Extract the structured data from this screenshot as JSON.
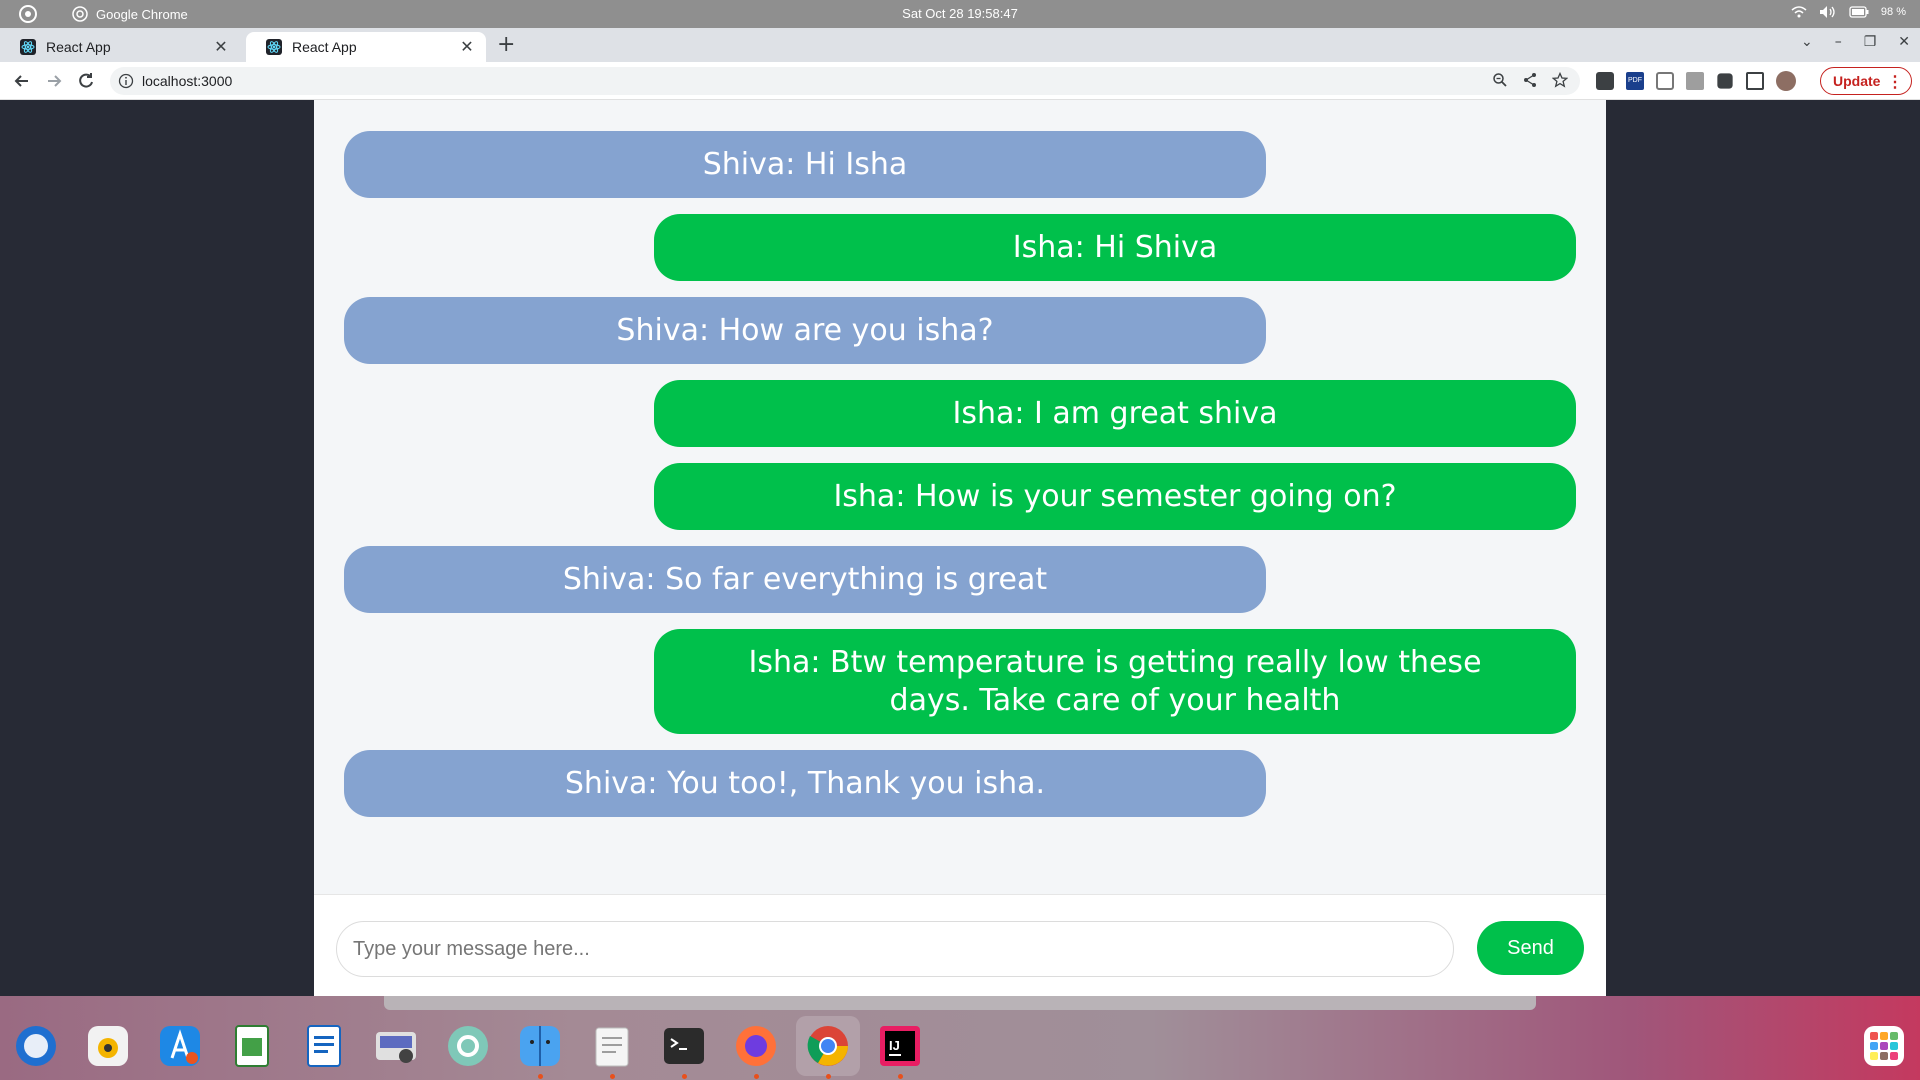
{
  "system_bar": {
    "app_name": "Google Chrome",
    "clock": "Sat Oct 28  19:58:47",
    "battery": "98 %"
  },
  "tabs": [
    {
      "label": "React App",
      "active": false
    },
    {
      "label": "React App",
      "active": true
    }
  ],
  "toolbar": {
    "url": "localhost:3000",
    "update_label": "Update"
  },
  "chat": {
    "messages": [
      {
        "sender": "Shiva",
        "text": "Shiva: Hi Isha"
      },
      {
        "sender": "Isha",
        "text": "Isha: Hi Shiva"
      },
      {
        "sender": "Shiva",
        "text": "Shiva: How are you isha?"
      },
      {
        "sender": "Isha",
        "text": "Isha: I am great shiva"
      },
      {
        "sender": "Isha",
        "text": "Isha: How is your semester going on?"
      },
      {
        "sender": "Shiva",
        "text": "Shiva: So far everything is great"
      },
      {
        "sender": "Isha",
        "text": "Isha: Btw temperature is getting really low these days. Take care of your health"
      },
      {
        "sender": "Shiva",
        "text": "Shiva: You too!, Thank you isha."
      }
    ],
    "input_placeholder": "Type your message here...",
    "send_label": "Send"
  },
  "colors": {
    "shiva_bubble": "#85a3d0",
    "isha_bubble": "#00c04b",
    "page_background": "#272a35",
    "chat_background": "#f4f6f8"
  },
  "dock": {
    "apps": [
      "thunderbird-icon",
      "rhythmbox-icon",
      "app-center-icon",
      "spreadsheet-icon",
      "document-viewer-icon",
      "screenshot-icon",
      "help-icon",
      "finder-icon",
      "text-editor-icon",
      "terminal-icon",
      "firefox-icon",
      "chrome-icon",
      "intellij-icon",
      "app-grid-icon"
    ]
  }
}
